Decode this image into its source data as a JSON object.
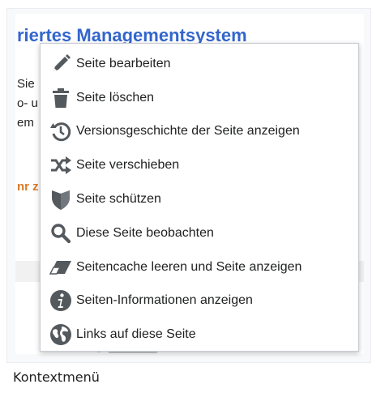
{
  "background": {
    "heading": "riertes Managementsystem",
    "lines": [
      "Sie",
      "o- u",
      "em"
    ],
    "orange_text": "nr z"
  },
  "menu": {
    "items": [
      {
        "label": "Seite bearbeiten",
        "icon": "pencil-icon"
      },
      {
        "label": "Seite löschen",
        "icon": "trash-icon"
      },
      {
        "label": "Versionsgeschichte der Seite anzeigen",
        "icon": "history-icon"
      },
      {
        "label": "Seite verschieben",
        "icon": "move-icon"
      },
      {
        "label": "Seite schützen",
        "icon": "shield-icon"
      },
      {
        "label": "Diese Seite beobachten",
        "icon": "magnifier-icon"
      },
      {
        "label": "Seitencache leeren und Seite anzeigen",
        "icon": "eraser-icon"
      },
      {
        "label": "Seiten-Informationen anzeigen",
        "icon": "info-icon"
      },
      {
        "label": "Links auf diese Seite",
        "icon": "globe-icon"
      }
    ]
  },
  "caption": "Kontextmenü",
  "colors": {
    "icon": "#54595d",
    "link": "#3366cc",
    "accent": "#d97a27"
  }
}
